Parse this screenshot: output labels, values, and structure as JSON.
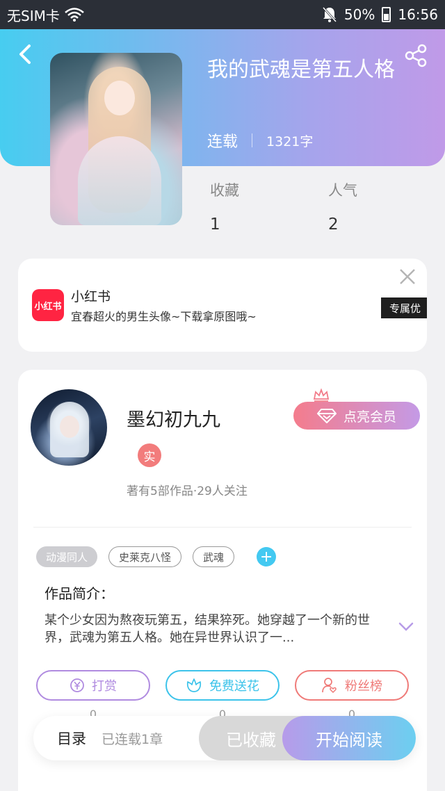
{
  "status_bar": {
    "carrier": "无SIM卡",
    "battery": "50%",
    "time": "16:56",
    "icons": [
      "wifi-icon",
      "bell-off-icon",
      "battery-icon"
    ]
  },
  "header": {
    "title": "我的武魂是第五人格",
    "status": "连载",
    "word_count": "1321字",
    "icons": [
      "back-arrow-icon",
      "share-icon"
    ]
  },
  "stats": [
    {
      "label": "收藏",
      "value": "1"
    },
    {
      "label": "人气",
      "value": "2"
    }
  ],
  "ad": {
    "brand_logo_text": "小红书",
    "brand": "小红书",
    "description": "宜春超火的男生头像~下载拿原图哦~",
    "chip": "专属优"
  },
  "author": {
    "name": "墨幻初九九",
    "badge": "实",
    "info": "著有5部作品·29人关注",
    "vip_button": "点亮会员"
  },
  "tags": [
    "动漫同人",
    "史莱克八怪",
    "武魂"
  ],
  "intro": {
    "title": "作品简介：",
    "text": "某个少女因为熬夜玩第五，结果猝死。她穿越了一个新的世界，武魂为第五人格。她在异世界认识了一..."
  },
  "actions": [
    {
      "label": "打赏",
      "count": "0",
      "color": "#b08be0",
      "icon": "yuan-coin-icon"
    },
    {
      "label": "免费送花",
      "count": "0",
      "color": "#3cc3ea",
      "icon": "flower-icon"
    },
    {
      "label": "粉丝榜",
      "count": "0",
      "color": "#ef7a78",
      "icon": "fan-user-icon"
    }
  ],
  "bottom_bar": {
    "toc_label": "目录",
    "toc_sub": "已连载1章",
    "collected_label": "已收藏",
    "read_label": "开始阅读"
  }
}
